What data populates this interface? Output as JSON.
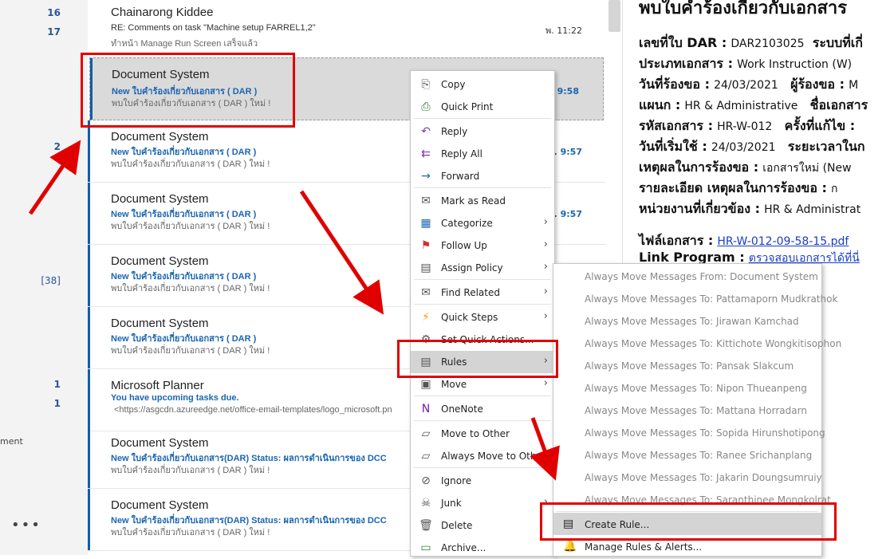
{
  "folder_strip": {
    "counts": [
      "16",
      "17",
      "2",
      "[38]",
      "1",
      "1"
    ],
    "label_fragment": "ment",
    "more": "•••"
  },
  "messages": [
    {
      "sender": "Chainarong Kiddee",
      "subject": "RE: Comments on task \"Machine setup FARREL1,2\"",
      "preview": "ทำหน้า Manage Run Screen เสร็จแล้ว",
      "time": "พ. 11:22",
      "unread": false
    },
    {
      "sender": "Document System",
      "subject": "New ใบคำร้องเกี่ยวกับเอกสาร ( DAR )",
      "preview": "พบใบคำร้องเกี่ยวกับเอกสาร ( DAR ) ใหม่ !",
      "time": "พ. 9:58",
      "unread": true
    },
    {
      "sender": "Document System",
      "subject": "New ใบคำร้องเกี่ยวกับเอกสาร ( DAR )",
      "preview": "พบใบคำร้องเกี่ยวกับเอกสาร ( DAR ) ใหม่ !",
      "time": "พ. 9:57",
      "unread": true
    },
    {
      "sender": "Document System",
      "subject": "New ใบคำร้องเกี่ยวกับเอกสาร ( DAR )",
      "preview": "พบใบคำร้องเกี่ยวกับเอกสาร ( DAR ) ใหม่ !",
      "time": "พ. 9:57",
      "unread": true
    },
    {
      "sender": "Document System",
      "subject": "New ใบคำร้องเกี่ยวกับเอกสาร ( DAR )",
      "preview": "พบใบคำร้องเกี่ยวกับเอกสาร ( DAR ) ใหม่ !",
      "time": "",
      "unread": true
    },
    {
      "sender": "Document System",
      "subject": "New ใบคำร้องเกี่ยวกับเอกสาร ( DAR )",
      "preview": "พบใบคำร้องเกี่ยวกับเอกสาร ( DAR ) ใหม่ !",
      "time": "",
      "unread": true
    },
    {
      "sender": "Microsoft Planner",
      "subject": "You have upcoming tasks due.",
      "preview": "<https://asgcdn.azureedge.net/office-email-templates/logo_microsoft.pn",
      "time": "",
      "unread": true
    },
    {
      "sender": "Document System",
      "subject": "New ใบคำร้องเกี่ยวกับเอกสาร(DAR) Status: ผลการดำเนินการของ DCC",
      "preview": "พบใบคำร้องเกี่ยวกับเอกสาร ( DAR ) ใหม่ !",
      "time": "",
      "unread": true
    },
    {
      "sender": "Document System",
      "subject": "New ใบคำร้องเกี่ยวกับเอกสาร(DAR) Status: ผลการดำเนินการของ DCC",
      "preview": "พบใบคำร้องเกี่ยวกับเอกสาร ( DAR ) ใหม่ !",
      "time": "",
      "unread": true
    }
  ],
  "reading_pane": {
    "title": "พบใบคำร้องเกี่ยวกับเอกสาร",
    "rows": [
      {
        "k1": "เลขที่ใบ DAR :",
        "v1": "DAR2103025",
        "k2": "ระบบที่เกี่",
        "v2": ""
      },
      {
        "k1": "ประเภทเอกสาร :",
        "v1": "Work Instruction (W)",
        "k2": "",
        "v2": ""
      },
      {
        "k1": "วันที่ร้องขอ :",
        "v1": "24/03/2021",
        "k2": "ผู้ร้องขอ :",
        "v2": "M"
      },
      {
        "k1": "แผนก :",
        "v1": "HR & Administrative",
        "k2": "ชื่อเอกสาร",
        "v2": ""
      },
      {
        "k1": "รหัสเอกสาร :",
        "v1": "HR-W-012",
        "k2": "ครั้งที่แก้ไข :",
        "v2": ""
      },
      {
        "k1": "วันที่เริ่มใช้ :",
        "v1": "24/03/2021",
        "k2": "ระยะเวลาในก",
        "v2": ""
      },
      {
        "k1": "เหตุผลในการร้องขอ :",
        "v1": "เอกสารใหม่ (New",
        "k2": "",
        "v2": ""
      },
      {
        "k1": "รายละเอียด เหตุผลในการร้องขอ :",
        "v1": "ก",
        "k2": "",
        "v2": ""
      },
      {
        "k1": "หน่วยงานที่เกี่ยวข้อง :",
        "v1": "HR & Administrat",
        "k2": "",
        "v2": ""
      }
    ],
    "file_label": "ไฟล์เอกสาร :",
    "file_link": "HR-W-012-09-58-15.pdf",
    "link_label": "Link Program :",
    "link_text": "ตรวจสอบเอกสารได้ที่นี่"
  },
  "context_menu": {
    "items": [
      {
        "label": "Copy",
        "icon": "copy-icon",
        "glyph": "⎘",
        "color": "#555",
        "submenu": false
      },
      {
        "label": "Quick Print",
        "icon": "print-icon",
        "glyph": "⎙",
        "color": "#2e7d32",
        "submenu": false
      },
      {
        "label": "Reply",
        "icon": "reply-icon",
        "glyph": "↶",
        "color": "#7b3fa0",
        "submenu": false
      },
      {
        "label": "Reply All",
        "icon": "reply-all-icon",
        "glyph": "⇇",
        "color": "#7b3fa0",
        "submenu": false
      },
      {
        "label": "Forward",
        "icon": "forward-icon",
        "glyph": "→",
        "color": "#1b65b2",
        "submenu": false
      },
      {
        "label": "Mark as Read",
        "icon": "envelope-open-icon",
        "glyph": "✉",
        "color": "#555",
        "submenu": false
      },
      {
        "label": "Categorize",
        "icon": "categorize-icon",
        "glyph": "▦",
        "color": "#1b65b2",
        "submenu": true
      },
      {
        "label": "Follow Up",
        "icon": "flag-icon",
        "glyph": "⚑",
        "color": "#d32f2f",
        "submenu": true
      },
      {
        "label": "Assign Policy",
        "icon": "policy-icon",
        "glyph": "▤",
        "color": "#555",
        "submenu": true
      },
      {
        "label": "Find Related",
        "icon": "find-related-icon",
        "glyph": "✉",
        "color": "#555",
        "submenu": true
      },
      {
        "label": "Quick Steps",
        "icon": "lightning-icon",
        "glyph": "⚡",
        "color": "#f0a000",
        "submenu": true
      },
      {
        "label": "Set Quick Actions...",
        "icon": "gear-icon",
        "glyph": "⚙",
        "color": "#555",
        "submenu": false
      },
      {
        "label": "Rules",
        "icon": "rules-icon",
        "glyph": "▤",
        "color": "#555",
        "submenu": true
      },
      {
        "label": "Move",
        "icon": "move-icon",
        "glyph": "▣",
        "color": "#555",
        "submenu": true
      },
      {
        "label": "OneNote",
        "icon": "onenote-icon",
        "glyph": "N",
        "color": "#7719aa",
        "submenu": false
      },
      {
        "label": "Move to Other",
        "icon": "move-other-icon",
        "glyph": "▱",
        "color": "#555",
        "submenu": false
      },
      {
        "label": "Always Move to Other",
        "icon": "always-move-other-icon",
        "glyph": "▱",
        "color": "#555",
        "submenu": false
      },
      {
        "label": "Ignore",
        "icon": "ignore-icon",
        "glyph": "⊘",
        "color": "#555",
        "submenu": false
      },
      {
        "label": "Junk",
        "icon": "junk-icon",
        "glyph": "☠",
        "color": "#555",
        "submenu": true
      },
      {
        "label": "Delete",
        "icon": "trash-icon",
        "glyph": "🗑",
        "color": "#555",
        "submenu": false
      },
      {
        "label": "Archive...",
        "icon": "archive-icon",
        "glyph": "▭",
        "color": "#2e7d32",
        "submenu": false
      }
    ]
  },
  "rules_submenu": {
    "items": [
      "Always Move Messages From: Document System",
      "Always Move Messages To: Pattamaporn Mudkrathok",
      "Always Move Messages To: Jirawan Kamchad",
      "Always Move Messages To: Kittichote Wongkitisophon",
      "Always Move Messages To: Pansak Slakcum",
      "Always Move Messages To: Nipon Thueanpeng",
      "Always Move Messages To: Mattana Horradarn",
      "Always Move Messages To: Sopida Hirunshotipong",
      "Always Move Messages To: Ranee Srichanplang",
      "Always Move Messages To: Jakarin Doungsumruiy",
      "Always Move Messages To: Saranthinee Mongkolrat"
    ],
    "create_rule": "Create Rule...",
    "manage_rules": "Manage Rules & Alerts..."
  },
  "colors": {
    "accent": "#0f5fa8",
    "annotation": "#e10000"
  }
}
